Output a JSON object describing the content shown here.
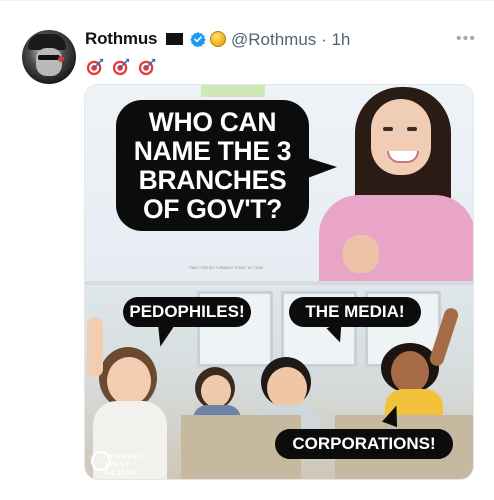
{
  "tweet": {
    "display_name": "Rothmus",
    "handle": "@Rothmus",
    "separator": "·",
    "time": "1h",
    "more_label": "•••",
    "emoji_row": [
      "dart-target",
      "dart-target",
      "dart-target"
    ],
    "badges": [
      "black-flag-icon",
      "verified-icon",
      "gold-badge-icon"
    ]
  },
  "meme": {
    "top_question": "WHO CAN NAME THE 3 BRANCHES OF GOV'T?",
    "top_question_lines": [
      "WHO CAN",
      "NAME THE 3",
      "BRANCHES",
      "OF GOV'T?"
    ],
    "answer_1": "PEDOPHILES!",
    "answer_2": "THE MEDIA!",
    "answer_3": "CORPORATIONS!",
    "logo_text_lines": [
      "TURNING",
      "POINT ACTION"
    ],
    "fine_print": "PAID FOR BY TURNING POINT ACTION"
  },
  "colors": {
    "name": "#0f1419",
    "muted": "#536471",
    "verified_blue": "#1d9bf0",
    "bubble": "#0c0c0c"
  }
}
